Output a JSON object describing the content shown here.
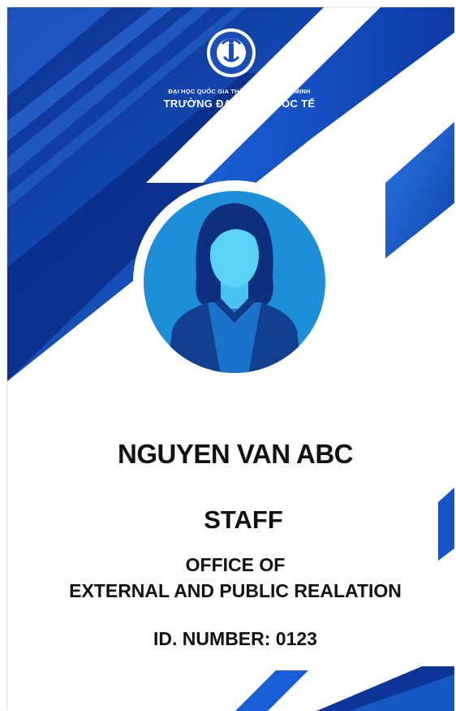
{
  "card": {
    "university_line1": "ĐẠI HỌC QUỐC GIA THÀNH PHỐ HỒ CHÍ MINH",
    "university_line2": "TRƯỜNG ĐẠI HỌC QUỐC TẾ",
    "logo_text": "HOCHIMINH CITY INTERNATIONAL UNIVERSITY · VNU-HCM · IU",
    "name": "NGUYEN VAN ABC",
    "role": "STAFF",
    "office_line1": "OFFICE OF",
    "office_line2": "EXTERNAL AND PUBLIC REALATION",
    "id_number": "ID. NUMBER: 0123"
  },
  "colors": {
    "primary_blue": "#1447b8",
    "dark_blue": "#0b2f8c",
    "bright_blue": "#1e6fe0",
    "avatar_bg": "#1d8fd9",
    "text": "#111111"
  }
}
